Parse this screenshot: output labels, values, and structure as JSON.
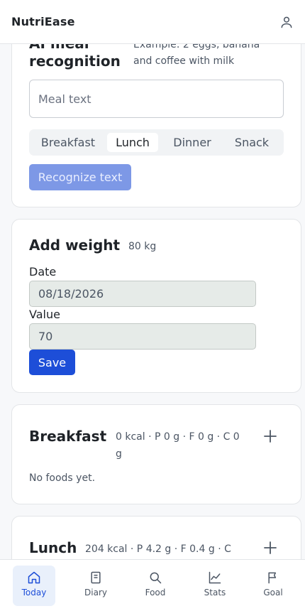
{
  "app": {
    "title": "NutriEase"
  },
  "colors": {
    "accent": "#1d4ed8",
    "accent_disabled": "#7d98e6",
    "nav_active_bg": "#e9f0fb"
  },
  "ai_meal": {
    "title": "AI meal recognition",
    "hint": "Example: 2 eggs, banana and coffee with milk",
    "input_placeholder": "Meal text",
    "input_value": "",
    "meal_types": [
      {
        "label": "Breakfast",
        "selected": false
      },
      {
        "label": "Lunch",
        "selected": true
      },
      {
        "label": "Dinner",
        "selected": false
      },
      {
        "label": "Snack",
        "selected": false
      }
    ],
    "recognize_label": "Recognize text"
  },
  "weight": {
    "title": "Add weight",
    "current": "80 kg",
    "date_label": "Date",
    "date_value": "08/18/2026",
    "value_label": "Value",
    "value_value": "70",
    "save_label": "Save"
  },
  "meals": {
    "breakfast": {
      "name": "Breakfast",
      "macros": "0 kcal · P 0 g · F 0 g · C 0 g",
      "empty_text": "No foods yet."
    },
    "lunch": {
      "name": "Lunch",
      "macros": "204 kcal · P 4.2 g · F 0.4 g · C"
    }
  },
  "nav": {
    "items": [
      {
        "label": "Today",
        "icon": "home-icon",
        "active": true
      },
      {
        "label": "Diary",
        "icon": "book-icon",
        "active": false
      },
      {
        "label": "Food",
        "icon": "search-icon",
        "active": false
      },
      {
        "label": "Stats",
        "icon": "chart-icon",
        "active": false
      },
      {
        "label": "Goal",
        "icon": "flag-icon",
        "active": false
      }
    ]
  }
}
